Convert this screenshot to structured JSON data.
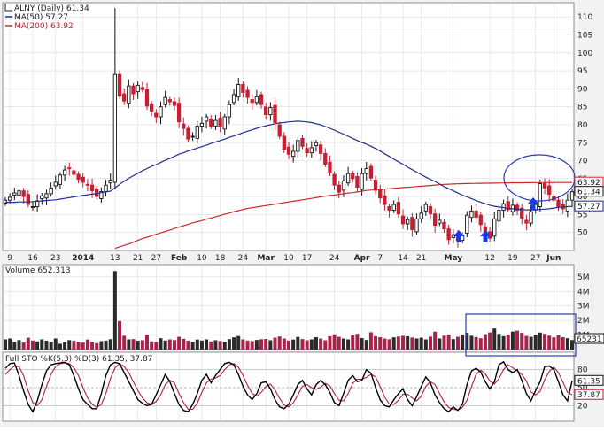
{
  "colors": {
    "up": "#111111",
    "down": "#c81e32",
    "ma50": "#1f2f8a",
    "ma200": "#cc2a2a",
    "volume_up": "#2a2a2a",
    "volume_down": "#a6244a",
    "k_line": "#000000",
    "d_line": "#b0203b",
    "annotation": "#2b3bb5",
    "arrow": "#1539e8",
    "bg": "#ffffff",
    "grid": "#d8dce6"
  },
  "price_panel": {
    "title": "ALNY (Daily) 61.34",
    "ma50_label": "MA(50) 57.27",
    "ma200_label": "MA(200) 63.92",
    "tags": {
      "ma200": "63.92",
      "last": "61.34",
      "ma50": "57.27"
    },
    "y_ticks": [
      50,
      55,
      60,
      65,
      70,
      75,
      80,
      85,
      90,
      95,
      100,
      105,
      110
    ]
  },
  "x_ticks": [
    "9",
    "16",
    "23",
    "2014",
    "13",
    "21",
    "27",
    "Feb",
    "10",
    "18",
    "24",
    "Mar",
    "10",
    "17",
    "24",
    "Apr",
    "7",
    "14",
    "21",
    "May",
    "12",
    "19",
    "27",
    "Jun"
  ],
  "volume_panel": {
    "title": "Volume 652,313",
    "y_ticks": [
      "1M",
      "2M",
      "3M",
      "4M",
      "5M"
    ],
    "tag": "65231"
  },
  "sto_panel": {
    "title": "Full STO %K(5,3) %D(3) 61.35, 37.87",
    "y_ticks": [
      "20",
      "50",
      "80"
    ],
    "tags": {
      "k": "61.35",
      "d": "37.87"
    }
  },
  "chart_data": {
    "type": "candlestick",
    "ticker": "ALNY",
    "ylim": [
      45,
      114
    ],
    "dates": [
      "Dec 6",
      "Dec 9",
      "Dec 10",
      "Dec 11",
      "Dec 12",
      "Dec 13",
      "Dec 16",
      "Dec 17",
      "Dec 18",
      "Dec 19",
      "Dec 20",
      "Dec 23",
      "Dec 24",
      "Dec 26",
      "Dec 27",
      "Dec 30",
      "Dec 31",
      "Jan 2",
      "Jan 3",
      "Jan 6",
      "Jan 7",
      "Jan 8",
      "Jan 9",
      "Jan 10",
      "Jan 13",
      "Jan 14",
      "Jan 15",
      "Jan 16",
      "Jan 17",
      "Jan 21",
      "Jan 22",
      "Jan 23",
      "Jan 24",
      "Jan 27",
      "Jan 28",
      "Jan 29",
      "Jan 30",
      "Jan 31",
      "Feb 3",
      "Feb 4",
      "Feb 5",
      "Feb 6",
      "Feb 7",
      "Feb 10",
      "Feb 11",
      "Feb 12",
      "Feb 13",
      "Feb 14",
      "Feb 18",
      "Feb 19",
      "Feb 20",
      "Feb 21",
      "Feb 24",
      "Feb 25",
      "Feb 26",
      "Feb 27",
      "Feb 28",
      "Mar 3",
      "Mar 4",
      "Mar 5",
      "Mar 6",
      "Mar 7",
      "Mar 10",
      "Mar 11",
      "Mar 12",
      "Mar 13",
      "Mar 14",
      "Mar 17",
      "Mar 18",
      "Mar 19",
      "Mar 20",
      "Mar 21",
      "Mar 24",
      "Mar 25",
      "Mar 26",
      "Mar 27",
      "Mar 28",
      "Mar 31",
      "Apr 1",
      "Apr 2",
      "Apr 3",
      "Apr 4",
      "Apr 7",
      "Apr 8",
      "Apr 9",
      "Apr 10",
      "Apr 11",
      "Apr 14",
      "Apr 15",
      "Apr 16",
      "Apr 17",
      "Apr 21",
      "Apr 22",
      "Apr 23",
      "Apr 24",
      "Apr 25",
      "Apr 28",
      "Apr 29",
      "Apr 30",
      "May 1",
      "May 2",
      "May 5",
      "May 6",
      "May 7",
      "May 8",
      "May 9",
      "May 12",
      "May 13",
      "May 14",
      "May 15",
      "May 16",
      "May 19",
      "May 20",
      "May 21",
      "May 22",
      "May 23",
      "May 27",
      "May 28",
      "May 29",
      "May 30",
      "Jun 2",
      "Jun 3",
      "Jun 4"
    ],
    "close": [
      59.0,
      59.8,
      61.0,
      61.6,
      60.0,
      57.8,
      57.2,
      58.8,
      60.2,
      60.8,
      62.4,
      64.0,
      66.0,
      67.4,
      67.8,
      66.2,
      64.8,
      64.0,
      63.2,
      61.6,
      60.0,
      61.4,
      63.2,
      64.6,
      94.0,
      88.0,
      86.6,
      90.8,
      88.6,
      91.0,
      89.8,
      85.2,
      83.8,
      82.2,
      85.0,
      87.6,
      86.4,
      85.4,
      80.8,
      79.0,
      76.0,
      76.8,
      79.6,
      80.4,
      82.2,
      79.6,
      81.2,
      79.4,
      82.2,
      85.6,
      88.4,
      91.2,
      89.0,
      87.6,
      86.2,
      87.8,
      85.6,
      82.8,
      84.8,
      80.6,
      76.8,
      73.2,
      71.8,
      72.6,
      75.6,
      74.0,
      72.2,
      73.6,
      75.0,
      72.0,
      69.0,
      66.8,
      63.2,
      61.2,
      64.4,
      66.4,
      65.0,
      62.6,
      66.4,
      67.8,
      65.2,
      61.8,
      59.6,
      57.8,
      56.2,
      57.8,
      55.2,
      52.4,
      53.6,
      50.8,
      53.8,
      55.4,
      57.8,
      55.2,
      52.0,
      53.4,
      51.0,
      48.0,
      49.4,
      47.8,
      49.2,
      54.8,
      56.0,
      54.2,
      52.2,
      50.2,
      48.4,
      53.8,
      56.2,
      58.0,
      56.4,
      57.6,
      56.2,
      54.0,
      52.6,
      55.8,
      57.8,
      63.6,
      62.4,
      60.6,
      59.0,
      57.2,
      56.6,
      59.0,
      61.34
    ],
    "ma50": [
      58.4,
      58.4,
      58.4,
      58.5,
      58.5,
      58.5,
      58.6,
      58.7,
      58.8,
      58.9,
      59.0,
      59.1,
      59.3,
      59.5,
      59.7,
      59.9,
      60.1,
      60.3,
      60.5,
      60.7,
      60.8,
      61.1,
      61.3,
      61.5,
      62.4,
      63.4,
      64.3,
      65.1,
      65.8,
      66.5,
      67.2,
      67.8,
      68.4,
      68.9,
      69.5,
      70.1,
      70.6,
      71.2,
      71.8,
      72.2,
      72.7,
      73.1,
      73.5,
      73.9,
      74.3,
      74.8,
      75.2,
      75.6,
      76.0,
      76.5,
      76.9,
      77.3,
      77.8,
      78.2,
      78.6,
      79.0,
      79.4,
      79.7,
      80.0,
      80.3,
      80.5,
      80.6,
      80.8,
      80.9,
      81.0,
      80.9,
      80.8,
      80.6,
      80.3,
      80.0,
      79.5,
      79.0,
      78.5,
      77.9,
      77.4,
      76.8,
      76.2,
      75.6,
      75.1,
      74.6,
      74.0,
      73.4,
      72.7,
      71.9,
      71.2,
      70.4,
      69.7,
      69.0,
      68.2,
      67.5,
      66.8,
      66.1,
      65.4,
      64.8,
      64.2,
      63.5,
      62.8,
      62.2,
      61.6,
      61.0,
      60.4,
      59.9,
      59.4,
      58.9,
      58.4,
      58.0,
      57.6,
      57.3,
      57.1,
      56.9,
      56.7,
      56.6,
      56.5,
      56.4,
      56.3,
      56.3,
      56.3,
      56.4,
      56.5,
      56.6,
      56.8,
      57.0,
      57.1,
      57.2,
      57.27
    ],
    "ma200": [
      null,
      null,
      null,
      null,
      null,
      null,
      null,
      null,
      null,
      null,
      null,
      null,
      null,
      null,
      null,
      null,
      null,
      null,
      null,
      null,
      null,
      null,
      null,
      null,
      45.6,
      46.0,
      46.4,
      46.8,
      47.3,
      47.8,
      48.3,
      48.7,
      49.1,
      49.5,
      49.9,
      50.3,
      50.7,
      51.1,
      51.5,
      51.9,
      52.3,
      52.7,
      53.0,
      53.3,
      53.7,
      54.0,
      54.4,
      54.7,
      55.1,
      55.4,
      55.8,
      56.1,
      56.4,
      56.7,
      56.9,
      57.1,
      57.3,
      57.5,
      57.7,
      57.9,
      58.1,
      58.3,
      58.5,
      58.7,
      58.9,
      59.1,
      59.3,
      59.5,
      59.7,
      59.9,
      60.1,
      60.3,
      60.4,
      60.6,
      60.8,
      61.0,
      61.1,
      61.3,
      61.5,
      61.7,
      61.8,
      61.9,
      62.0,
      62.1,
      62.2,
      62.3,
      62.4,
      62.5,
      62.6,
      62.7,
      62.8,
      62.9,
      63.0,
      63.1,
      63.2,
      63.3,
      63.4,
      63.45,
      63.5,
      63.55,
      63.6,
      63.62,
      63.65,
      63.68,
      63.7,
      63.72,
      63.74,
      63.76,
      63.78,
      63.8,
      63.82,
      63.84,
      63.85,
      63.86,
      63.87,
      63.88,
      63.89,
      63.9,
      63.9,
      63.91,
      63.91,
      63.92,
      63.92,
      63.92,
      63.92
    ],
    "volume_ylim": [
      0,
      5600000
    ],
    "volume": [
      700000,
      760000,
      520000,
      650000,
      480000,
      820000,
      620000,
      560000,
      700000,
      610000,
      520000,
      760000,
      400000,
      500000,
      650000,
      600000,
      530000,
      480000,
      690000,
      520000,
      440000,
      580000,
      620000,
      710000,
      5400000,
      1950000,
      950000,
      700000,
      720000,
      610000,
      640000,
      1020000,
      560000,
      520000,
      780000,
      620000,
      700000,
      650000,
      880000,
      740000,
      610000,
      520000,
      690000,
      620000,
      700000,
      560000,
      640000,
      590000,
      520000,
      720000,
      840000,
      930000,
      700000,
      620000,
      580000,
      660000,
      710000,
      730000,
      640000,
      820000,
      900000,
      760000,
      620000,
      690000,
      870000,
      720000,
      640000,
      700000,
      850000,
      760000,
      640000,
      920000,
      1050000,
      880000,
      760000,
      700000,
      980000,
      1080000,
      790000,
      660000,
      1190000,
      920000,
      850000,
      760000,
      710000,
      840000,
      900000,
      950000,
      920000,
      830000,
      760000,
      820000,
      700000,
      890000,
      1230000,
      760000,
      960000,
      1040000,
      720000,
      880000,
      1040000,
      1150000,
      950000,
      860000,
      780000,
      1060000,
      1180000,
      1450000,
      1080000,
      920000,
      1040000,
      1240000,
      1300000,
      1150000,
      940000,
      880000,
      1020000,
      1170000,
      1090000,
      960000,
      840000,
      1000000,
      850000,
      780000,
      652313
    ],
    "sto_k": [
      82,
      90,
      91,
      70,
      45,
      22,
      10,
      28,
      55,
      78,
      88,
      90,
      91,
      92,
      88,
      70,
      48,
      30,
      22,
      15,
      15,
      40,
      70,
      88,
      92,
      90,
      75,
      60,
      45,
      30,
      24,
      20,
      22,
      38,
      55,
      72,
      60,
      40,
      22,
      12,
      10,
      22,
      40,
      62,
      72,
      58,
      70,
      80,
      90,
      92,
      88,
      72,
      52,
      38,
      30,
      40,
      58,
      60,
      48,
      30,
      18,
      15,
      22,
      38,
      55,
      62,
      48,
      38,
      55,
      62,
      55,
      42,
      25,
      20,
      40,
      62,
      70,
      60,
      62,
      80,
      74,
      50,
      30,
      20,
      18,
      30,
      40,
      48,
      30,
      20,
      35,
      52,
      68,
      58,
      38,
      25,
      15,
      10,
      18,
      12,
      22,
      55,
      78,
      82,
      76,
      60,
      48,
      60,
      88,
      93,
      80,
      75,
      80,
      62,
      40,
      28,
      45,
      60,
      85,
      86,
      80,
      60,
      38,
      28,
      61.35
    ],
    "sto_d": [
      72,
      80,
      86,
      85,
      70,
      45,
      25,
      20,
      30,
      52,
      72,
      85,
      90,
      91,
      90,
      83,
      70,
      50,
      33,
      22,
      17,
      22,
      40,
      65,
      83,
      90,
      85,
      75,
      60,
      45,
      33,
      25,
      22,
      27,
      38,
      55,
      62,
      58,
      40,
      25,
      14,
      14,
      24,
      42,
      58,
      64,
      66,
      70,
      80,
      88,
      90,
      84,
      70,
      54,
      40,
      36,
      42,
      52,
      56,
      46,
      32,
      21,
      18,
      25,
      38,
      52,
      55,
      50,
      47,
      51,
      57,
      53,
      40,
      29,
      28,
      40,
      57,
      64,
      64,
      67,
      72,
      68,
      52,
      34,
      23,
      22,
      29,
      39,
      39,
      33,
      28,
      36,
      52,
      60,
      55,
      40,
      26,
      17,
      14,
      13,
      17,
      29,
      52,
      72,
      79,
      73,
      61,
      56,
      65,
      80,
      88,
      83,
      78,
      72,
      61,
      43,
      38,
      44,
      63,
      77,
      84,
      75,
      59,
      42,
      37.87
    ]
  }
}
